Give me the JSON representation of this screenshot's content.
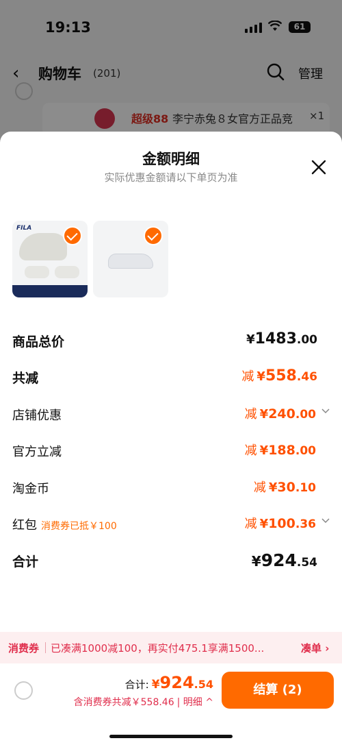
{
  "status_bar": {
    "time": "19:13",
    "battery": "61"
  },
  "nav": {
    "back": "‹",
    "title": "购物车",
    "count": "(201)",
    "manage": "管理"
  },
  "bg_item": {
    "tag": "超级88",
    "name": "李宁赤兔８女官方正品竞",
    "qty": "×1"
  },
  "sheet": {
    "title": "金额明细",
    "subtitle": "实际优惠金额请以下单页为准",
    "product1_logo": "FILA"
  },
  "rows": {
    "total_goods": {
      "label": "商品总价",
      "sym": "¥",
      "int": "1483",
      "dec": ".00"
    },
    "total_discount": {
      "label": "共减",
      "prefix": "减",
      "sym": "¥",
      "int": "558",
      "dec": ".46"
    },
    "shop_discount": {
      "label": "店铺优惠",
      "prefix": "减",
      "sym": "¥",
      "int": "240",
      "dec": ".00"
    },
    "official_discount": {
      "label": "官方立减",
      "prefix": "减",
      "sym": "¥",
      "int": "188",
      "dec": ".00"
    },
    "taojinbi": {
      "label": "淘金币",
      "prefix": "减",
      "sym": "¥",
      "int": "30",
      "dec": ".10"
    },
    "hongbao": {
      "label": "红包",
      "note": "消费券已抵￥100",
      "prefix": "减",
      "sym": "¥",
      "int": "100",
      "dec": ".36"
    },
    "sum": {
      "label": "合计",
      "sym": "¥",
      "int": "924",
      "dec": ".54"
    }
  },
  "coupon": {
    "label": "消费券",
    "text": "已凑满1000减100，再实付475.1享满1500...",
    "action": "凑单 ›"
  },
  "bottom": {
    "total_label": "合计:",
    "sym": "¥",
    "int": "924",
    "dec": ".54",
    "sub": "含消费券共减￥558.46",
    "detail": "| 明细 ^",
    "checkout": "结算 (2)"
  },
  "colors": {
    "accent": "#ff6a00",
    "discount": "#ff5000",
    "coupon_text": "#e02e4c"
  }
}
